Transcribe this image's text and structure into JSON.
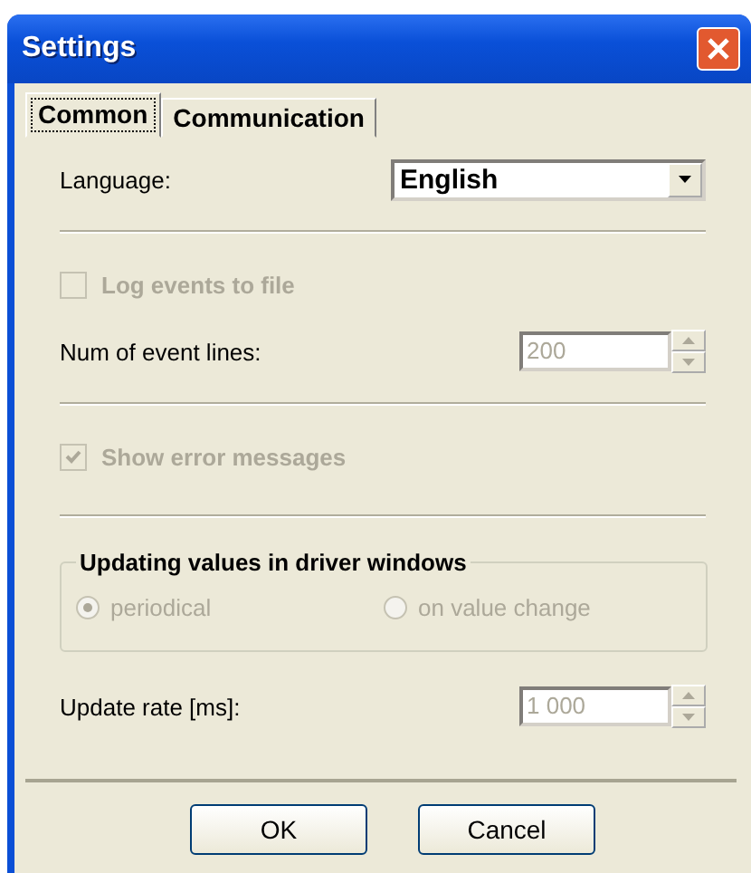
{
  "window": {
    "title": "Settings"
  },
  "tabs": [
    {
      "label": "Common",
      "selected": true
    },
    {
      "label": "Communication",
      "selected": false
    }
  ],
  "language": {
    "label": "Language:",
    "value": "English"
  },
  "log_events": {
    "label": "Log events to file",
    "checked": false,
    "disabled": true
  },
  "event_lines": {
    "label": "Num of event lines:",
    "value": "200",
    "disabled": true
  },
  "show_errors": {
    "label": "Show error messages",
    "checked": true,
    "disabled": true
  },
  "update_group": {
    "title": "Updating values in driver windows",
    "options": [
      {
        "label": "periodical",
        "selected": true,
        "disabled": true
      },
      {
        "label": "on value change",
        "selected": false,
        "disabled": true
      }
    ]
  },
  "update_rate": {
    "label": "Update rate [ms]:",
    "value": "1 000",
    "disabled": true
  },
  "buttons": [
    "OK",
    "Cancel"
  ]
}
